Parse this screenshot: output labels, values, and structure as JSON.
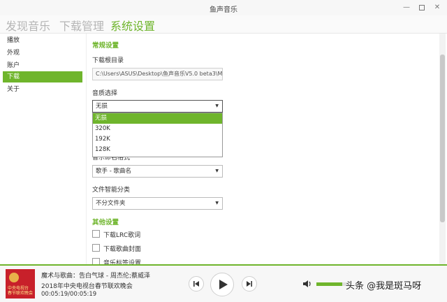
{
  "window": {
    "title": "鱼声音乐"
  },
  "nav": {
    "tabs": [
      {
        "label": "发现音乐",
        "active": false
      },
      {
        "label": "下载管理",
        "active": false
      },
      {
        "label": "系统设置",
        "active": true
      }
    ]
  },
  "sidebar": {
    "items": [
      {
        "label": "播放",
        "active": false
      },
      {
        "label": "外观",
        "active": false
      },
      {
        "label": "账户",
        "active": false
      },
      {
        "label": "下载",
        "active": true
      },
      {
        "label": "关于",
        "active": false
      }
    ]
  },
  "settings": {
    "general": {
      "title": "常规设置",
      "download_dir_label": "下载根目录",
      "download_dir_value": "C:\\Users\\ASUS\\Desktop\\鱼声音乐V5.0 beta3\\M",
      "quality_label": "音质选择",
      "quality_selected": "无损",
      "quality_options": [
        "无损",
        "320K",
        "192K",
        "128K"
      ],
      "naming_label_partial": "音乐命名格式",
      "naming_selected": "歌手 - 歌曲名",
      "smart_sort_label": "文件智能分类",
      "smart_sort_selected": "不分文件夹"
    },
    "other": {
      "title": "其他设置",
      "options": [
        {
          "label": "下载LRC歌词",
          "checked": false
        },
        {
          "label": "下载歌曲封面",
          "checked": false
        },
        {
          "label": "音乐标签设置",
          "checked": false
        }
      ]
    }
  },
  "player": {
    "album_caption": "中央电视台\n春节联欢晚会",
    "song_title": "魔术与歌曲：告白气球 - 周杰伦;蔡威泽",
    "song_subtitle": "2018年中央电视台春节联欢晚会",
    "time": "00:05:19/00:05:19",
    "volume_level": 0.85
  },
  "watermark": "头条 @我是斑马呀",
  "colors": {
    "accent": "#6fb52c",
    "album_red": "#c8202a"
  },
  "icons": [
    "minimize-icon",
    "maximize-icon",
    "close-icon",
    "chevron-down-icon",
    "previous-icon",
    "play-icon",
    "next-icon",
    "volume-icon"
  ]
}
